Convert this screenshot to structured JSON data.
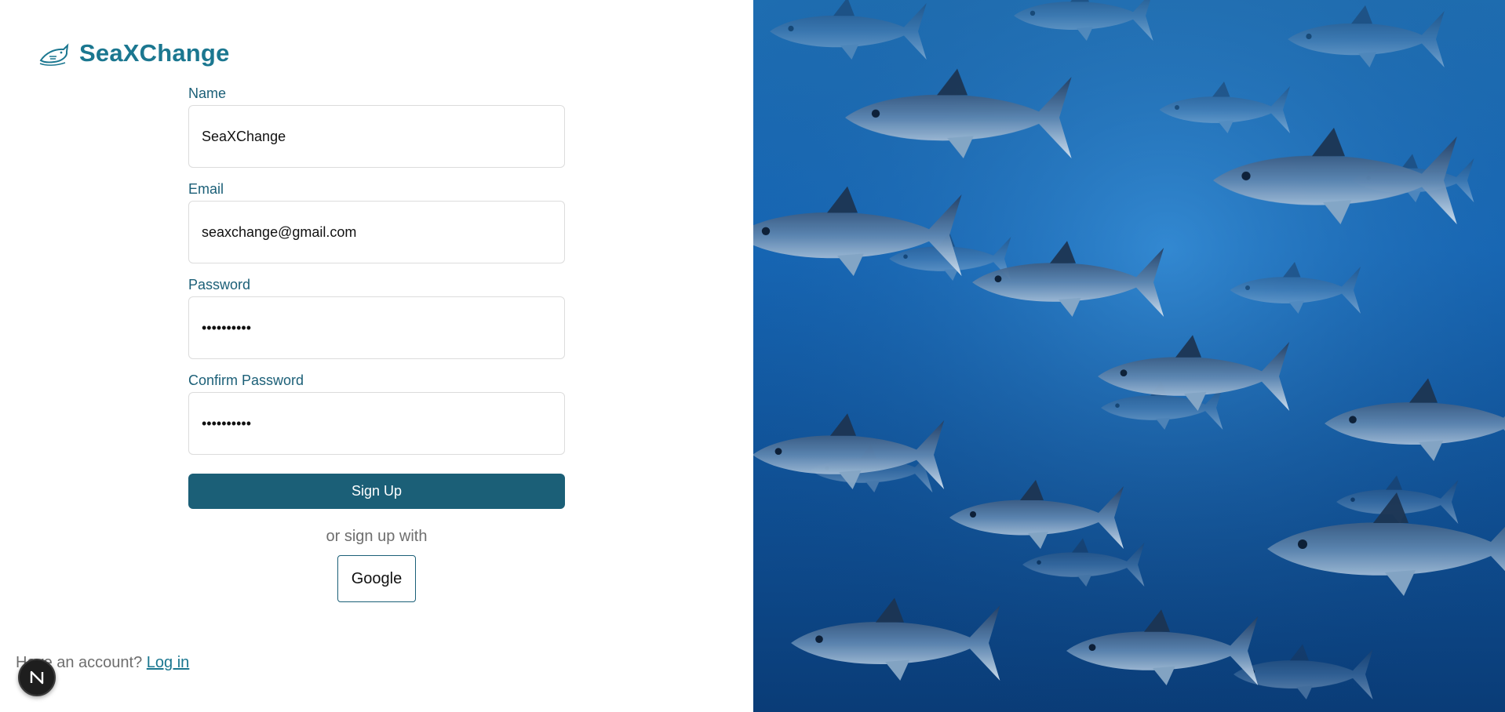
{
  "brand": {
    "name": "SeaXChange",
    "logo_icon": "fish-logo-icon",
    "accent_color": "#1b7790"
  },
  "form": {
    "name_label": "Name",
    "name_value": "SeaXChange",
    "email_label": "Email",
    "email_value": "seaxchange@gmail.com",
    "password_label": "Password",
    "password_value": "••••••••••",
    "confirm_label": "Confirm Password",
    "confirm_value": "••••••••••",
    "submit_label": "Sign Up",
    "submit_color": "#1b5f77"
  },
  "alt_signup": {
    "text": "or sign up with",
    "google_label": "Google"
  },
  "login": {
    "prompt": "Have an account?",
    "link_label": "Log in"
  },
  "dev_badge": {
    "icon": "nextjs-n-icon",
    "letter": "N"
  },
  "hero": {
    "image": "school-of-tuna-underwater-photo"
  }
}
